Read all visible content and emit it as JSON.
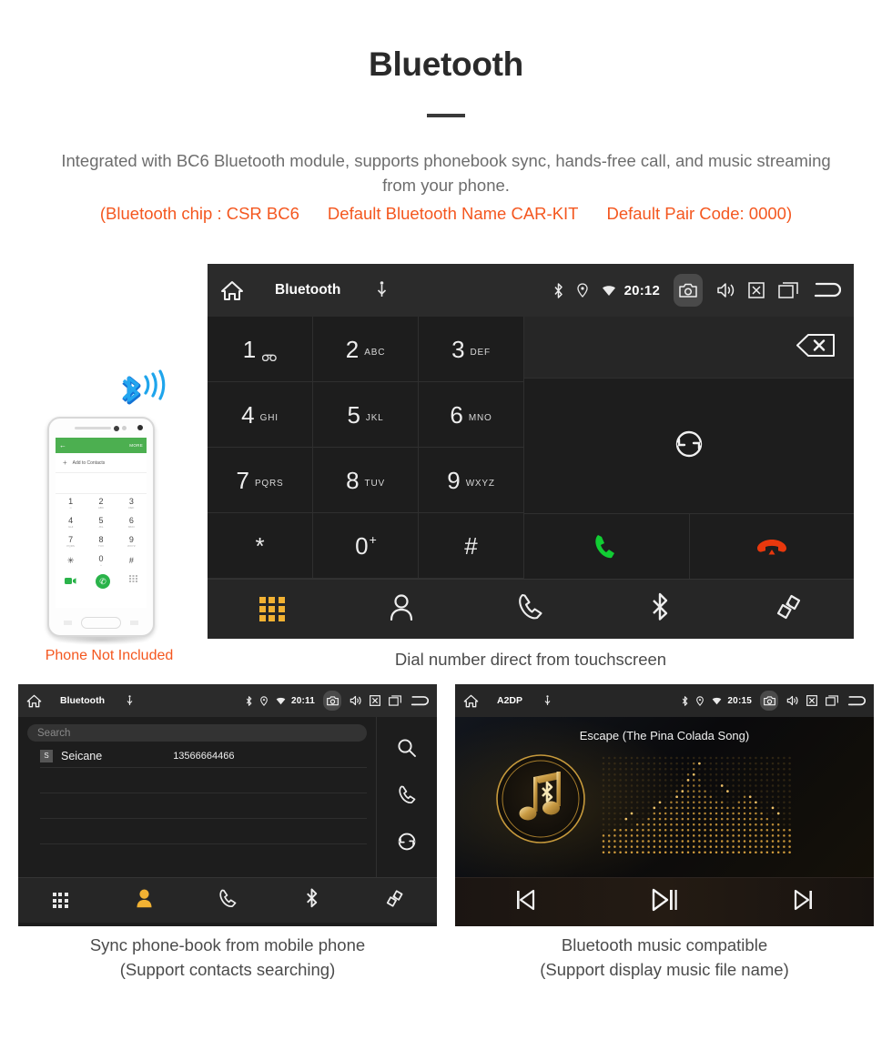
{
  "header": {
    "title": "Bluetooth",
    "description": "Integrated with BC6 Bluetooth module, supports phonebook sync, hands-free call, and music streaming from your phone.",
    "specs": [
      "(Bluetooth chip : CSR BC6",
      "Default Bluetooth Name CAR-KIT",
      "Default Pair Code: 0000)"
    ],
    "accent_color": "#f4571f",
    "text_color": "#6d6d6d"
  },
  "phone_mock": {
    "app_back": "←",
    "app_more": "MORE",
    "add_to_contacts": "Add to Contacts",
    "keys": [
      {
        "digit": "1",
        "sub": "∞"
      },
      {
        "digit": "2",
        "sub": "ABC"
      },
      {
        "digit": "3",
        "sub": "DEF"
      },
      {
        "digit": "4",
        "sub": "GHI"
      },
      {
        "digit": "5",
        "sub": "JKL"
      },
      {
        "digit": "6",
        "sub": "MNO"
      },
      {
        "digit": "7",
        "sub": "PQRS"
      },
      {
        "digit": "8",
        "sub": "TUV"
      },
      {
        "digit": "9",
        "sub": "WXYZ"
      },
      {
        "digit": "✳",
        "sub": ""
      },
      {
        "digit": "0",
        "sub": "+"
      },
      {
        "digit": "#",
        "sub": ""
      }
    ],
    "caption": "Phone Not Included",
    "caption_color": "#f4571f",
    "bluetooth_logo_color": "#1a9ae8"
  },
  "dialer_panel": {
    "statusbar": {
      "home_icon": "home-icon",
      "title": "Bluetooth",
      "usb_icon": "usb-icon",
      "bluetooth_icon": "bluetooth-icon",
      "location_icon": "location-pin-icon",
      "wifi_icon": "wifi-icon",
      "time": "20:12",
      "camera_icon": "camera-icon",
      "volume_icon": "volume-icon",
      "close_icon": "close-box-icon",
      "recents_icon": "recents-icon",
      "back_icon": "back-arrow-icon"
    },
    "keys": [
      {
        "digit": "1",
        "sub": "",
        "voicemail": true
      },
      {
        "digit": "2",
        "sub": "ABC"
      },
      {
        "digit": "3",
        "sub": "DEF"
      },
      {
        "digit": "4",
        "sub": "GHI"
      },
      {
        "digit": "5",
        "sub": "JKL"
      },
      {
        "digit": "6",
        "sub": "MNO"
      },
      {
        "digit": "7",
        "sub": "PQRS"
      },
      {
        "digit": "8",
        "sub": "TUV"
      },
      {
        "digit": "9",
        "sub": "WXYZ"
      },
      {
        "digit": "*",
        "sub": ""
      },
      {
        "digit": "0",
        "sup": "+"
      },
      {
        "digit": "#",
        "sub": ""
      }
    ],
    "number_value": "",
    "backspace_icon": "backspace-icon",
    "sync_icon": "sync-icon",
    "call_button_color": "#11cc33",
    "hangup_button_color": "#e8380d",
    "tabs": [
      {
        "name": "keypad",
        "icon": "keypad-icon",
        "active": true
      },
      {
        "name": "contacts",
        "icon": "contact-person-icon",
        "active": false
      },
      {
        "name": "call-log",
        "icon": "phone-handset-icon",
        "active": false
      },
      {
        "name": "bluetooth",
        "icon": "bluetooth-icon",
        "active": false
      },
      {
        "name": "pair-link",
        "icon": "link-chain-icon",
        "active": false
      }
    ],
    "caption": "Dial number direct from touchscreen",
    "active_tab_color": "#f2b233"
  },
  "contacts_panel": {
    "statusbar": {
      "title": "Bluetooth",
      "time": "20:11"
    },
    "search_placeholder": "Search",
    "contacts": [
      {
        "initial": "S",
        "name": "Seicane",
        "number": "13566664466"
      }
    ],
    "side_actions": [
      {
        "name": "search",
        "icon": "search-icon"
      },
      {
        "name": "call",
        "icon": "phone-handset-icon"
      },
      {
        "name": "sync",
        "icon": "sync-icon"
      }
    ],
    "tabs": [
      {
        "name": "keypad",
        "icon": "keypad-icon",
        "active": false
      },
      {
        "name": "contacts",
        "icon": "contact-person-icon",
        "active": true
      },
      {
        "name": "call-log",
        "icon": "phone-handset-icon",
        "active": false
      },
      {
        "name": "bluetooth",
        "icon": "bluetooth-icon",
        "active": false
      },
      {
        "name": "pair-link",
        "icon": "link-chain-icon",
        "active": false
      }
    ],
    "caption_line1": "Sync phone-book from mobile phone",
    "caption_line2": "(Support contacts searching)"
  },
  "music_panel": {
    "statusbar": {
      "title": "A2DP",
      "time": "20:15"
    },
    "song_title": "Escape (The Pina Colada Song)",
    "album_icon": "music-note-bluetooth-icon",
    "visualizer": "dot-matrix-spectrum",
    "controls": [
      {
        "name": "previous",
        "icon": "skip-previous-icon"
      },
      {
        "name": "play-pause",
        "icon": "play-pause-icon"
      },
      {
        "name": "next",
        "icon": "skip-next-icon"
      }
    ],
    "accent_color": "#c79a3c",
    "caption_line1": "Bluetooth music compatible",
    "caption_line2": "(Support display music file name)"
  }
}
